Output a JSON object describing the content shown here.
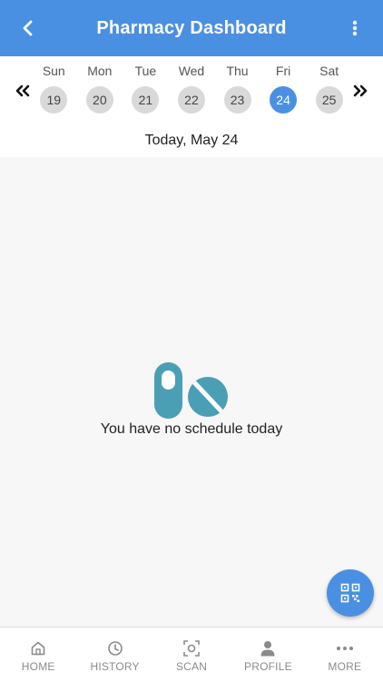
{
  "header": {
    "title": "Pharmacy Dashboard",
    "back_icon": "chevron-left-icon",
    "more_icon": "more-vertical-icon",
    "color": "#4a90e2"
  },
  "calendar": {
    "prev_icon": "double-chevron-left-icon",
    "next_icon": "double-chevron-right-icon",
    "days": [
      {
        "name": "Sun",
        "number": "19"
      },
      {
        "name": "Mon",
        "number": "20"
      },
      {
        "name": "Tue",
        "number": "21"
      },
      {
        "name": "Wed",
        "number": "22"
      },
      {
        "name": "Thu",
        "number": "23"
      },
      {
        "name": "Fri",
        "number": "24",
        "selected": true
      },
      {
        "name": "Sat",
        "number": "25"
      }
    ],
    "today_label": "Today, May 24",
    "selected_color": "#4a90e2"
  },
  "empty_state": {
    "icon": "pills-icon",
    "message": "You have no schedule today",
    "icon_color": "#4a9fb5"
  },
  "fab": {
    "icon": "qr-code-icon",
    "color": "#4a90e2"
  },
  "bottom_nav": {
    "items": [
      {
        "label": "HOME",
        "icon": "home-icon"
      },
      {
        "label": "HISTORY",
        "icon": "clock-icon"
      },
      {
        "label": "SCAN",
        "icon": "scan-icon"
      },
      {
        "label": "PROFILE",
        "icon": "person-icon"
      },
      {
        "label": "MORE",
        "icon": "more-horizontal-icon"
      }
    ]
  }
}
